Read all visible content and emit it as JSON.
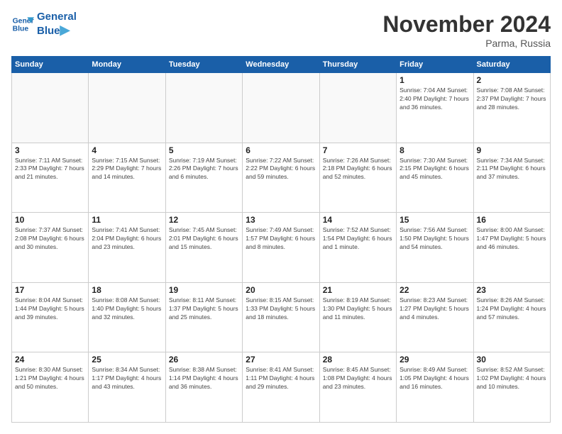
{
  "logo": {
    "line1": "General",
    "line2": "Blue"
  },
  "header": {
    "title": "November 2024",
    "location": "Parma, Russia"
  },
  "weekdays": [
    "Sunday",
    "Monday",
    "Tuesday",
    "Wednesday",
    "Thursday",
    "Friday",
    "Saturday"
  ],
  "weeks": [
    [
      {
        "day": "",
        "info": ""
      },
      {
        "day": "",
        "info": ""
      },
      {
        "day": "",
        "info": ""
      },
      {
        "day": "",
        "info": ""
      },
      {
        "day": "",
        "info": ""
      },
      {
        "day": "1",
        "info": "Sunrise: 7:04 AM\nSunset: 2:40 PM\nDaylight: 7 hours\nand 36 minutes."
      },
      {
        "day": "2",
        "info": "Sunrise: 7:08 AM\nSunset: 2:37 PM\nDaylight: 7 hours\nand 28 minutes."
      }
    ],
    [
      {
        "day": "3",
        "info": "Sunrise: 7:11 AM\nSunset: 2:33 PM\nDaylight: 7 hours\nand 21 minutes."
      },
      {
        "day": "4",
        "info": "Sunrise: 7:15 AM\nSunset: 2:29 PM\nDaylight: 7 hours\nand 14 minutes."
      },
      {
        "day": "5",
        "info": "Sunrise: 7:19 AM\nSunset: 2:26 PM\nDaylight: 7 hours\nand 6 minutes."
      },
      {
        "day": "6",
        "info": "Sunrise: 7:22 AM\nSunset: 2:22 PM\nDaylight: 6 hours\nand 59 minutes."
      },
      {
        "day": "7",
        "info": "Sunrise: 7:26 AM\nSunset: 2:18 PM\nDaylight: 6 hours\nand 52 minutes."
      },
      {
        "day": "8",
        "info": "Sunrise: 7:30 AM\nSunset: 2:15 PM\nDaylight: 6 hours\nand 45 minutes."
      },
      {
        "day": "9",
        "info": "Sunrise: 7:34 AM\nSunset: 2:11 PM\nDaylight: 6 hours\nand 37 minutes."
      }
    ],
    [
      {
        "day": "10",
        "info": "Sunrise: 7:37 AM\nSunset: 2:08 PM\nDaylight: 6 hours\nand 30 minutes."
      },
      {
        "day": "11",
        "info": "Sunrise: 7:41 AM\nSunset: 2:04 PM\nDaylight: 6 hours\nand 23 minutes."
      },
      {
        "day": "12",
        "info": "Sunrise: 7:45 AM\nSunset: 2:01 PM\nDaylight: 6 hours\nand 15 minutes."
      },
      {
        "day": "13",
        "info": "Sunrise: 7:49 AM\nSunset: 1:57 PM\nDaylight: 6 hours\nand 8 minutes."
      },
      {
        "day": "14",
        "info": "Sunrise: 7:52 AM\nSunset: 1:54 PM\nDaylight: 6 hours\nand 1 minute."
      },
      {
        "day": "15",
        "info": "Sunrise: 7:56 AM\nSunset: 1:50 PM\nDaylight: 5 hours\nand 54 minutes."
      },
      {
        "day": "16",
        "info": "Sunrise: 8:00 AM\nSunset: 1:47 PM\nDaylight: 5 hours\nand 46 minutes."
      }
    ],
    [
      {
        "day": "17",
        "info": "Sunrise: 8:04 AM\nSunset: 1:44 PM\nDaylight: 5 hours\nand 39 minutes."
      },
      {
        "day": "18",
        "info": "Sunrise: 8:08 AM\nSunset: 1:40 PM\nDaylight: 5 hours\nand 32 minutes."
      },
      {
        "day": "19",
        "info": "Sunrise: 8:11 AM\nSunset: 1:37 PM\nDaylight: 5 hours\nand 25 minutes."
      },
      {
        "day": "20",
        "info": "Sunrise: 8:15 AM\nSunset: 1:33 PM\nDaylight: 5 hours\nand 18 minutes."
      },
      {
        "day": "21",
        "info": "Sunrise: 8:19 AM\nSunset: 1:30 PM\nDaylight: 5 hours\nand 11 minutes."
      },
      {
        "day": "22",
        "info": "Sunrise: 8:23 AM\nSunset: 1:27 PM\nDaylight: 5 hours\nand 4 minutes."
      },
      {
        "day": "23",
        "info": "Sunrise: 8:26 AM\nSunset: 1:24 PM\nDaylight: 4 hours\nand 57 minutes."
      }
    ],
    [
      {
        "day": "24",
        "info": "Sunrise: 8:30 AM\nSunset: 1:21 PM\nDaylight: 4 hours\nand 50 minutes."
      },
      {
        "day": "25",
        "info": "Sunrise: 8:34 AM\nSunset: 1:17 PM\nDaylight: 4 hours\nand 43 minutes."
      },
      {
        "day": "26",
        "info": "Sunrise: 8:38 AM\nSunset: 1:14 PM\nDaylight: 4 hours\nand 36 minutes."
      },
      {
        "day": "27",
        "info": "Sunrise: 8:41 AM\nSunset: 1:11 PM\nDaylight: 4 hours\nand 29 minutes."
      },
      {
        "day": "28",
        "info": "Sunrise: 8:45 AM\nSunset: 1:08 PM\nDaylight: 4 hours\nand 23 minutes."
      },
      {
        "day": "29",
        "info": "Sunrise: 8:49 AM\nSunset: 1:05 PM\nDaylight: 4 hours\nand 16 minutes."
      },
      {
        "day": "30",
        "info": "Sunrise: 8:52 AM\nSunset: 1:02 PM\nDaylight: 4 hours\nand 10 minutes."
      }
    ]
  ]
}
